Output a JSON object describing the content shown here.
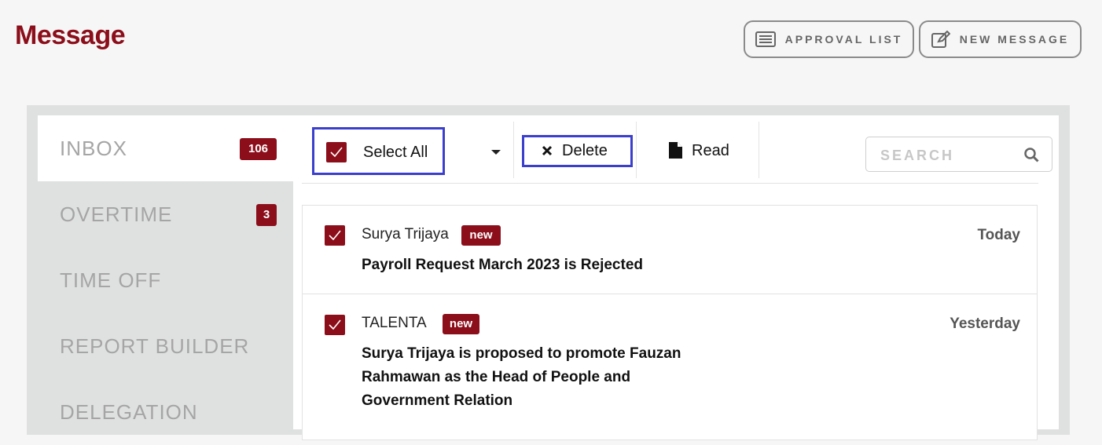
{
  "page": {
    "title": "Message"
  },
  "header": {
    "approval_label": "APPROVAL LIST",
    "new_message_label": "NEW MESSAGE"
  },
  "sidebar": {
    "items": [
      {
        "label": "INBOX",
        "badge": "106",
        "active": true
      },
      {
        "label": "OVERTIME",
        "badge": "3"
      },
      {
        "label": "TIME OFF"
      },
      {
        "label": "REPORT BUILDER"
      },
      {
        "label": "DELEGATION"
      }
    ]
  },
  "toolbar": {
    "select_all_label": "Select All",
    "delete_label": "Delete",
    "read_label": "Read",
    "search_placeholder": "SEARCH"
  },
  "messages": [
    {
      "sender": "Surya Trijaya",
      "badge": "new",
      "date": "Today",
      "subject": "Payroll Request March 2023 is Rejected",
      "checked": true
    },
    {
      "sender": "TALENTA",
      "badge": "new",
      "date": "Yesterday",
      "subject_lines": [
        "Surya Trijaya is proposed to promote Fauzan",
        "Rahmawan as the Head of People and",
        "Government Relation"
      ],
      "checked": true
    }
  ],
  "colors": {
    "accent": "#8b0e1a",
    "highlight_border": "#3b3fcc"
  }
}
